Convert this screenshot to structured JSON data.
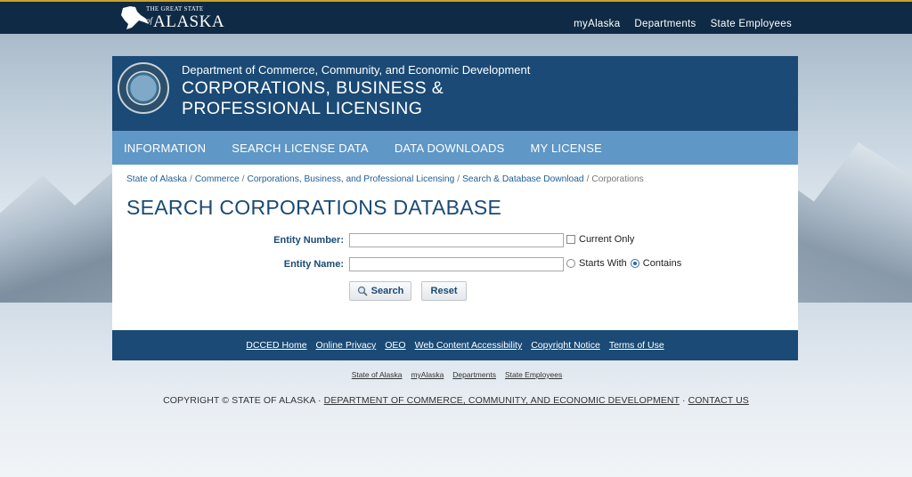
{
  "brand": {
    "small": "THE GREAT STATE",
    "of": "of",
    "big": "ALASKA"
  },
  "topnav": [
    "myAlaska",
    "Departments",
    "State Employees"
  ],
  "header": {
    "department": "Department of Commerce, Community, and Economic Development",
    "title_line1": "CORPORATIONS, BUSINESS &",
    "title_line2": "PROFESSIONAL LICENSING"
  },
  "mainnav": [
    "INFORMATION",
    "SEARCH LICENSE DATA",
    "DATA DOWNLOADS",
    "MY LICENSE"
  ],
  "breadcrumb": {
    "links": [
      "State of Alaska",
      "Commerce",
      "Corporations, Business, and Professional Licensing",
      "Search & Database Download"
    ],
    "current": "Corporations",
    "separator": "/"
  },
  "page_title": "SEARCH CORPORATIONS DATABASE",
  "form": {
    "entity_number_label": "Entity Number:",
    "entity_number_value": "",
    "current_only_label": "Current Only",
    "entity_name_label": "Entity Name:",
    "entity_name_value": "",
    "starts_with_label": "Starts With",
    "contains_label": "Contains",
    "search_label": "Search",
    "reset_label": "Reset"
  },
  "footer_links": [
    "DCCED Home",
    "Online Privacy",
    "OEO",
    "Web Content Accessibility",
    "Copyright Notice",
    "Terms of Use"
  ],
  "sub_links": [
    "State of Alaska",
    "myAlaska",
    "Departments",
    "State Employees"
  ],
  "copyright": {
    "prefix": "COPYRIGHT © STATE OF ALASKA · ",
    "dept_link": "DEPARTMENT OF COMMERCE, COMMUNITY, AND ECONOMIC DEVELOPMENT",
    "middle": " · ",
    "contact_link": "CONTACT US"
  },
  "colors": {
    "topbar": "#0f2a44",
    "header": "#1a4a75",
    "nav": "#5f97c6",
    "accent": "#c9a227"
  }
}
